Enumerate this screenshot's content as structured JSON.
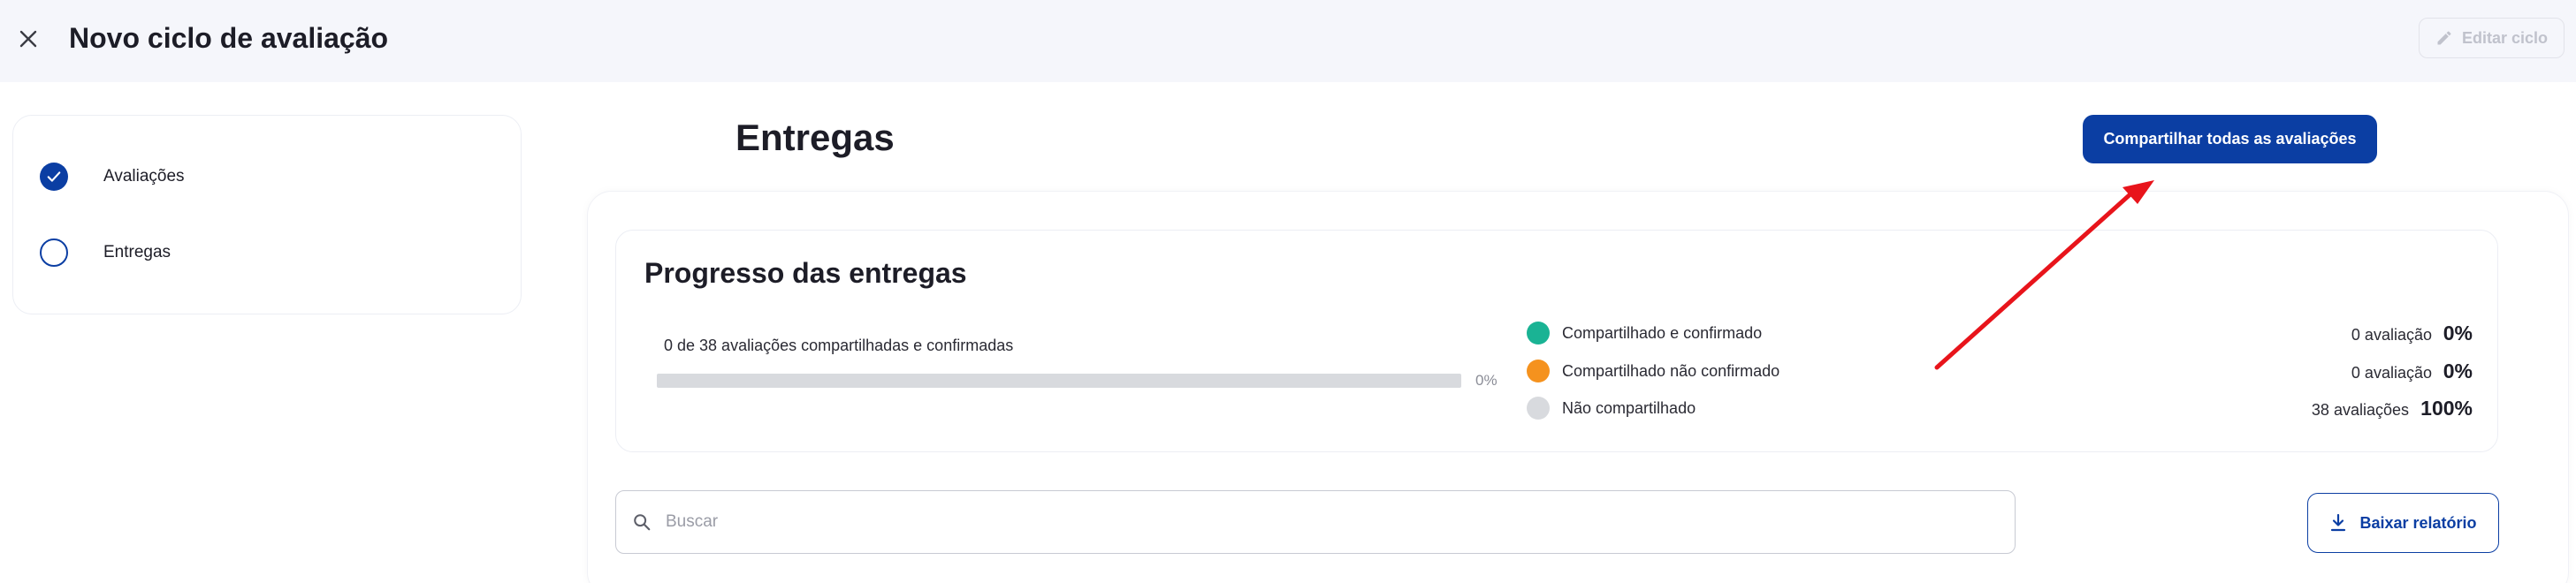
{
  "header": {
    "title": "Novo ciclo de avaliação",
    "edit_label": "Editar ciclo",
    "close_icon": "close-icon",
    "edit_icon": "pencil-icon"
  },
  "stepper": {
    "items": [
      {
        "label": "Avaliações",
        "state": "done"
      },
      {
        "label": "Entregas",
        "state": "current"
      }
    ]
  },
  "main": {
    "title": "Entregas",
    "share_all_label": "Compartilhar todas as avaliações"
  },
  "progress": {
    "title": "Progresso das entregas",
    "summary": "0 de 38 avaliações compartilhadas e confirmadas",
    "bar_value_percent": 0,
    "bar_label": "0%",
    "legend": [
      {
        "label": "Compartilhado e confirmado",
        "color": "#1ab394",
        "count_text": "0 avaliação",
        "percent_text": "0%"
      },
      {
        "label": "Compartilhado não confirmado",
        "color": "#f5921e",
        "count_text": "0 avaliação",
        "percent_text": "0%"
      },
      {
        "label": "Não compartilhado",
        "color": "#d8dade",
        "count_text": "38 avaliações",
        "percent_text": "100%"
      }
    ]
  },
  "search": {
    "placeholder": "Buscar",
    "value": ""
  },
  "download": {
    "label": "Baixar relatório",
    "icon": "download-icon"
  },
  "colors": {
    "primary": "#0b3ea3",
    "annotation_arrow": "#e8141b"
  }
}
